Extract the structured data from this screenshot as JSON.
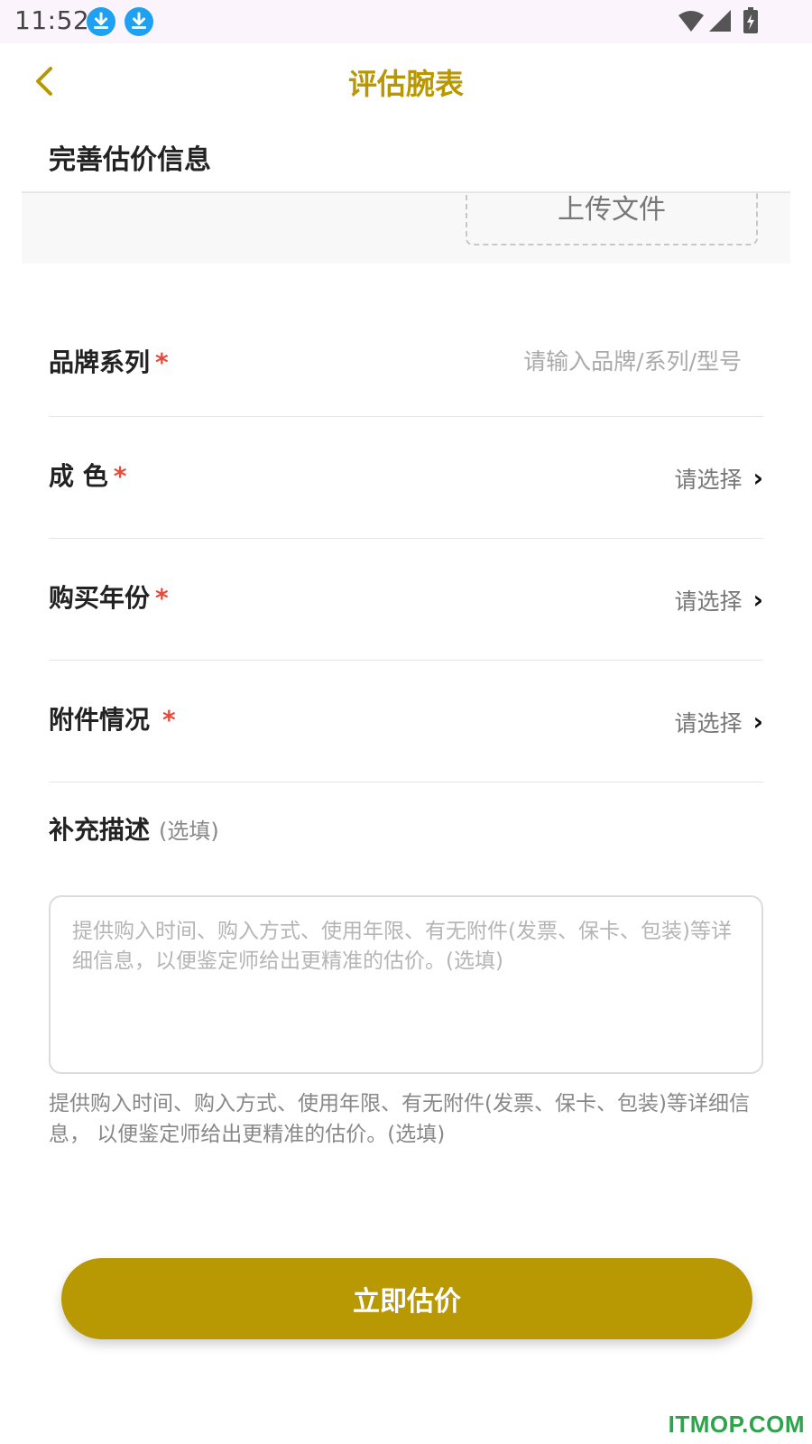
{
  "status_bar": {
    "time": "11:52",
    "icons": [
      "download-icon",
      "download-icon",
      "wifi-icon",
      "signal-icon",
      "battery-charging-icon"
    ],
    "download_icon_color": "#1ea1f2"
  },
  "header": {
    "back_icon": "chevron-left-icon",
    "title": "评估腕表",
    "accent_color": "#b89700"
  },
  "section": {
    "title": "完善估价信息",
    "upload_label": "上传文件"
  },
  "form": {
    "required_mark": "*",
    "brand": {
      "label": "品牌系列",
      "placeholder": "请输入品牌/系列/型号",
      "value": ""
    },
    "condition": {
      "label": "成 色",
      "select_label": "请选择",
      "chevron": "›"
    },
    "purchase_year": {
      "label": "购买年份",
      "select_label": "请选择",
      "chevron": "›"
    },
    "accessories": {
      "label": "附件情况",
      "select_label": "请选择",
      "chevron": "›"
    }
  },
  "description": {
    "title": "补充描述",
    "optional": "(选填)",
    "placeholder": "提供购入时间、购入方式、使用年限、有无附件(发票、保卡、包装)等详细信息，以便鉴定师给出更精准的估价。(选填)",
    "value": "",
    "hint": "提供购入时间、购入方式、使用年限、有无附件(发票、保卡、包装)等详细信息， 以便鉴定师给出更精准的估价。(选填)"
  },
  "submit": {
    "label": "立即估价",
    "color": "#b89803"
  },
  "watermark": {
    "text": "ITMOP.COM",
    "color": "#2ba44a"
  }
}
